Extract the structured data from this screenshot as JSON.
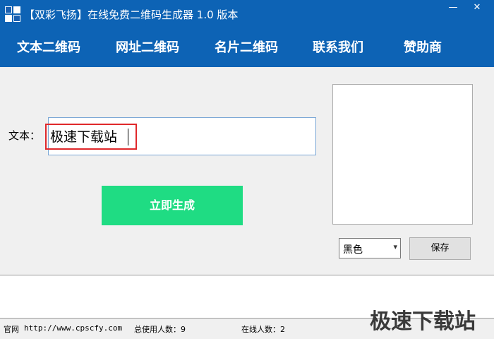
{
  "window": {
    "title": "【双彩飞扬】在线免费二维码生成器 1.0 版本",
    "minimize_glyph": "—",
    "close_glyph": "✕"
  },
  "nav": {
    "items": [
      {
        "label": "文本二维码"
      },
      {
        "label": "网址二维码"
      },
      {
        "label": "名片二维码"
      },
      {
        "label": "联系我们"
      },
      {
        "label": "赞助商"
      }
    ]
  },
  "form": {
    "text_label": "文本：",
    "text_value": "极速下载站",
    "generate_label": "立即生成"
  },
  "qr": {
    "color_selected": "黑色",
    "dropdown_glyph": "▾",
    "save_label": "保存"
  },
  "status": {
    "site_label": "官网",
    "site_url": "http://www.cpscfy.com",
    "total_users_label": "总使用人数：9",
    "online_users_label": "在线人数：2"
  },
  "watermark": "极速下载站",
  "colors": {
    "titlebar": "#0d63b5",
    "generate_button": "#1fdc83",
    "highlight": "#e0282b"
  }
}
